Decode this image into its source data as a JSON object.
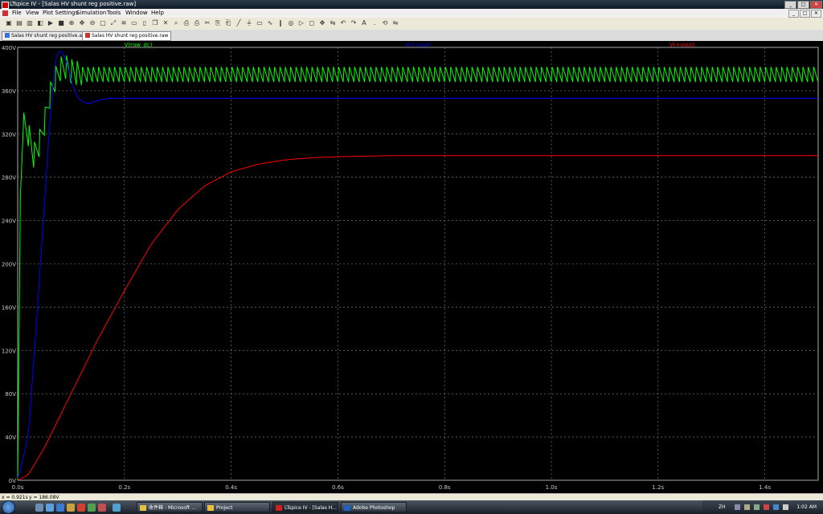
{
  "window": {
    "title": "LTspice IV - [Salas HV shunt reg positive.raw]",
    "buttons": [
      "_",
      "□",
      "✕"
    ]
  },
  "menu": {
    "items": [
      "File",
      "View",
      "Plot Settings",
      "Simulation",
      "Tools",
      "Window",
      "Help"
    ],
    "mdi_buttons": [
      "_",
      "□",
      "✕"
    ]
  },
  "toolbar": {
    "icons": [
      "new-schematic-icon",
      "open-icon",
      "save-icon",
      "control-panel-icon",
      "run-icon",
      "halt-icon",
      "zoom-in-icon",
      "zoom-pan-icon",
      "zoom-out-icon",
      "zoom-fit-icon",
      "autorange-icon",
      "fft-icon",
      "tile-horizontal-icon",
      "tile-vertical-icon",
      "cascade-icon",
      "close-icon",
      "find-icon",
      "print-setup-icon",
      "print-icon",
      "cut-icon",
      "copy-icon",
      "paste-icon",
      "wire-icon",
      "ground-icon",
      "label-icon",
      "resistor-icon",
      "capacitor-icon",
      "inductor-icon",
      "diode-icon",
      "component-icon",
      "move-icon",
      "drag-icon",
      "undo-icon",
      "redo-icon",
      "text-icon",
      "spice-directive-icon",
      "rotate-icon",
      "mirror-icon"
    ]
  },
  "tabs": [
    {
      "label": "Salas HV shunt reg positive.asc",
      "icon": "schematic-icon",
      "active": false
    },
    {
      "label": "Salas HV shunt reg positive.raw",
      "icon": "waveform-icon",
      "active": true
    }
  ],
  "colors": {
    "background": "#000000",
    "grid": "#888888",
    "axis_text": "#c8c8c8",
    "raw_dc": "#00ff00",
    "vout_blue": "#0000ff",
    "vout_red": "#ff0000"
  },
  "chart_data": {
    "type": "line",
    "xlim": [
      0,
      1.5
    ],
    "ylim": [
      0,
      400
    ],
    "x_ticks": [
      "0.0s",
      "0.2s",
      "0.4s",
      "0.6s",
      "0.8s",
      "1.0s",
      "1.2s",
      "1.4s"
    ],
    "y_ticks": [
      "0V",
      "40V",
      "80V",
      "120V",
      "160V",
      "200V",
      "240V",
      "280V",
      "320V",
      "360V",
      "400V"
    ],
    "grid": true,
    "series": [
      {
        "name": "V(raw_dc)",
        "color": "#00ff00",
        "x": [
          0,
          0.005,
          0.01,
          0.02,
          0.03,
          0.04,
          0.05,
          0.06,
          0.07,
          0.08,
          0.09,
          0.1,
          0.12,
          0.15,
          0.2,
          0.5,
          1.0,
          1.5
        ],
        "y": [
          0,
          260,
          330,
          320,
          300,
          310,
          330,
          355,
          370,
          380,
          382,
          378,
          375,
          375,
          375,
          375,
          375,
          375
        ],
        "ripple_pp": 14
      },
      {
        "name": "V(+vout)",
        "color": "#0000ff",
        "x": [
          0,
          0.02,
          0.04,
          0.06,
          0.07,
          0.08,
          0.09,
          0.1,
          0.11,
          0.12,
          0.13,
          0.14,
          0.15,
          0.17,
          0.2,
          0.5,
          1.0,
          1.5
        ],
        "y": [
          0,
          40,
          180,
          330,
          390,
          398,
          390,
          370,
          355,
          350,
          348,
          349,
          351,
          353,
          353,
          353,
          353,
          353
        ]
      },
      {
        "name": "V(+vout)",
        "color": "#ff0000",
        "x": [
          0,
          0.02,
          0.05,
          0.1,
          0.15,
          0.2,
          0.25,
          0.3,
          0.35,
          0.4,
          0.45,
          0.5,
          0.55,
          0.6,
          0.7,
          0.8,
          1.0,
          1.2,
          1.5
        ],
        "y": [
          0,
          5,
          30,
          80,
          130,
          175,
          218,
          250,
          272,
          285,
          292,
          296,
          298,
          299,
          300,
          300,
          300,
          300,
          300
        ]
      }
    ]
  },
  "status": {
    "x": "x = 0.921s",
    "y": "y = 186.08V"
  },
  "taskbar": {
    "tasks": [
      {
        "label": "收件箱 - Microsoft ...",
        "active": false,
        "icon_color": "#e8c040"
      },
      {
        "label": "Project",
        "active": false,
        "icon_color": "#e8c040"
      },
      {
        "label": "LTspice IV - [Salas H...",
        "active": true,
        "icon_color": "#d02020"
      },
      {
        "label": "Adobe Photoshop",
        "active": false,
        "icon_color": "#2060c0"
      }
    ],
    "lang": "ZH",
    "clock": "1:02 AM"
  }
}
